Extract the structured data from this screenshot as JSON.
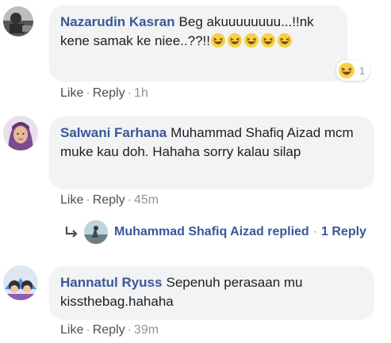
{
  "comments": [
    {
      "author": "Nazarudin Kasran",
      "text": "Beg akuuuuuuuu...!!nk kene samak ke niee..??!!",
      "emoji_count": 5,
      "reaction": {
        "icon": "laughing-emoji-icon",
        "count": "1"
      },
      "actions": {
        "like": "Like",
        "reply": "Reply",
        "time": "1h"
      }
    },
    {
      "author": "Salwani Farhana",
      "text": "Muhammad Shafiq Aizad mcm muke kau doh. Hahaha sorry kalau silap",
      "actions": {
        "like": "Like",
        "reply": "Reply",
        "time": "45m"
      },
      "replies": {
        "author": "Muhammad Shafiq Aizad",
        "replied": "replied",
        "count": "1 Reply"
      }
    },
    {
      "author": "Hannatul Ryuss",
      "text": "Sepenuh perasaan mu kissthebag.hahaha",
      "actions": {
        "like": "Like",
        "reply": "Reply",
        "time": "39m"
      }
    }
  ],
  "colors": {
    "author": "#385898",
    "bubble": "#f2f3f5",
    "meta": "#90949c"
  }
}
